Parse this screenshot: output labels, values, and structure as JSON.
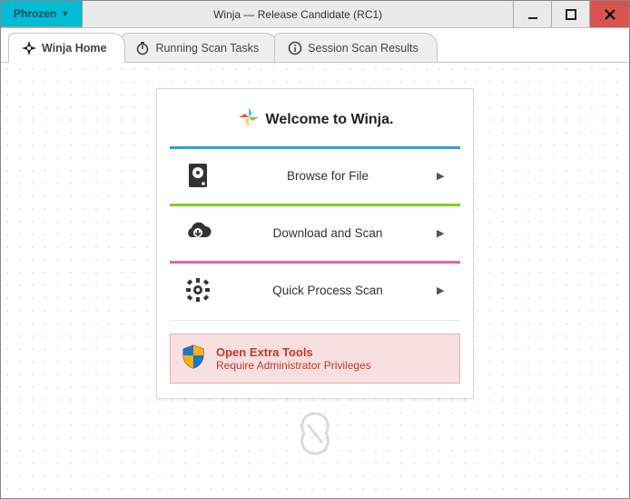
{
  "titlebar": {
    "menu_label": "Phrozen",
    "window_title": "Winja — Release Candidate (RC1)"
  },
  "tabs": [
    {
      "label": "Winja Home"
    },
    {
      "label": "Running Scan Tasks"
    },
    {
      "label": "Session Scan Results"
    }
  ],
  "home": {
    "welcome": "Welcome to Winja.",
    "options": [
      {
        "label": "Browse for File"
      },
      {
        "label": "Download and Scan"
      },
      {
        "label": "Quick Process Scan"
      }
    ],
    "extra": {
      "title": "Open Extra Tools",
      "subtitle": "Require Administrator Privileges"
    }
  }
}
